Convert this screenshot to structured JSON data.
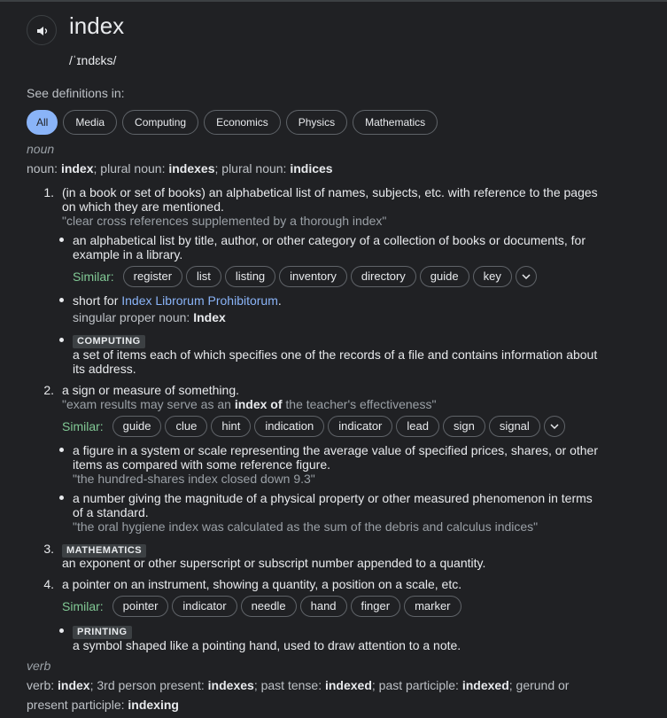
{
  "entry": {
    "word": "index",
    "phonetic": "/ˈɪndɛks/",
    "see_definitions_label": "See definitions in:"
  },
  "tabs": [
    "All",
    "Media",
    "Computing",
    "Economics",
    "Physics",
    "Mathematics"
  ],
  "noun": {
    "pos": "noun",
    "grammar": {
      "prefix": "noun:",
      "word": "index",
      "plural1_label": "; plural noun:",
      "plural1": "indexes",
      "plural2_label": "; plural noun:",
      "plural2": "indices"
    },
    "sense1": {
      "number": "1.",
      "def_line1": "(in a book or set of books) an alphabetical list of names, subjects, etc. with reference to the pages",
      "def_line2": "on which they are mentioned.",
      "example": "\"clear cross references supplemented by a thorough index\"",
      "sub1_line1": "an alphabetical list by title, author, or other category of a collection of books or documents, for",
      "sub1_line2": "example in a library.",
      "similar_label": "Similar:",
      "similar": [
        "register",
        "list",
        "listing",
        "inventory",
        "directory",
        "guide",
        "key"
      ],
      "sub2_prefix": "short for",
      "sub2_link": "Index Librorum Prohibitorum",
      "sub2_suffix": ".",
      "sub2_gram_label": "singular proper noun:",
      "sub2_gram_word": "Index",
      "sub3_label": "COMPUTING",
      "sub3_line1": "a set of items each of which specifies one of the records of a file and contains information about",
      "sub3_line2": "its address."
    },
    "sense2": {
      "number": "2.",
      "def": "a sign or measure of something.",
      "example_pre": "\"exam results may serve as an",
      "example_bold": "index of",
      "example_post": "the teacher's effectiveness\"",
      "similar_label": "Similar:",
      "similar": [
        "guide",
        "clue",
        "hint",
        "indication",
        "indicator",
        "lead",
        "sign",
        "signal"
      ],
      "sub1_line1": "a figure in a system or scale representing the average value of specified prices, shares, or other",
      "sub1_line2": "items as compared with some reference figure.",
      "sub1_example": "\"the hundred-shares index closed down 9.3\"",
      "sub2_line1": "a number giving the magnitude of a physical property or other measured phenomenon in terms",
      "sub2_line2": "of a standard.",
      "sub2_example": "\"the oral hygiene index was calculated as the sum of the debris and calculus indices\""
    },
    "sense3": {
      "number": "3.",
      "label": "MATHEMATICS",
      "def": "an exponent or other superscript or subscript number appended to a quantity."
    },
    "sense4": {
      "number": "4.",
      "def": "a pointer on an instrument, showing a quantity, a position on a scale, etc.",
      "similar_label": "Similar:",
      "similar": [
        "pointer",
        "indicator",
        "needle",
        "hand",
        "finger",
        "marker"
      ],
      "sub1_label": "PRINTING",
      "sub1_def": "a symbol shaped like a pointing hand, used to draw attention to a note."
    }
  },
  "verb": {
    "pos": "verb",
    "l1_prefix": "verb:",
    "word": "index",
    "p3_label": "; 3rd person present:",
    "p3": "indexes",
    "past_label": "; past tense:",
    "past": "indexed",
    "pp_label": "; past participle:",
    "pp": "indexed",
    "ger_label": "; gerund or",
    "ger_label2": "present participle:",
    "ger": "indexing"
  },
  "icons": {
    "speaker": "speaker-icon",
    "chevron": "chevron-down-icon"
  }
}
